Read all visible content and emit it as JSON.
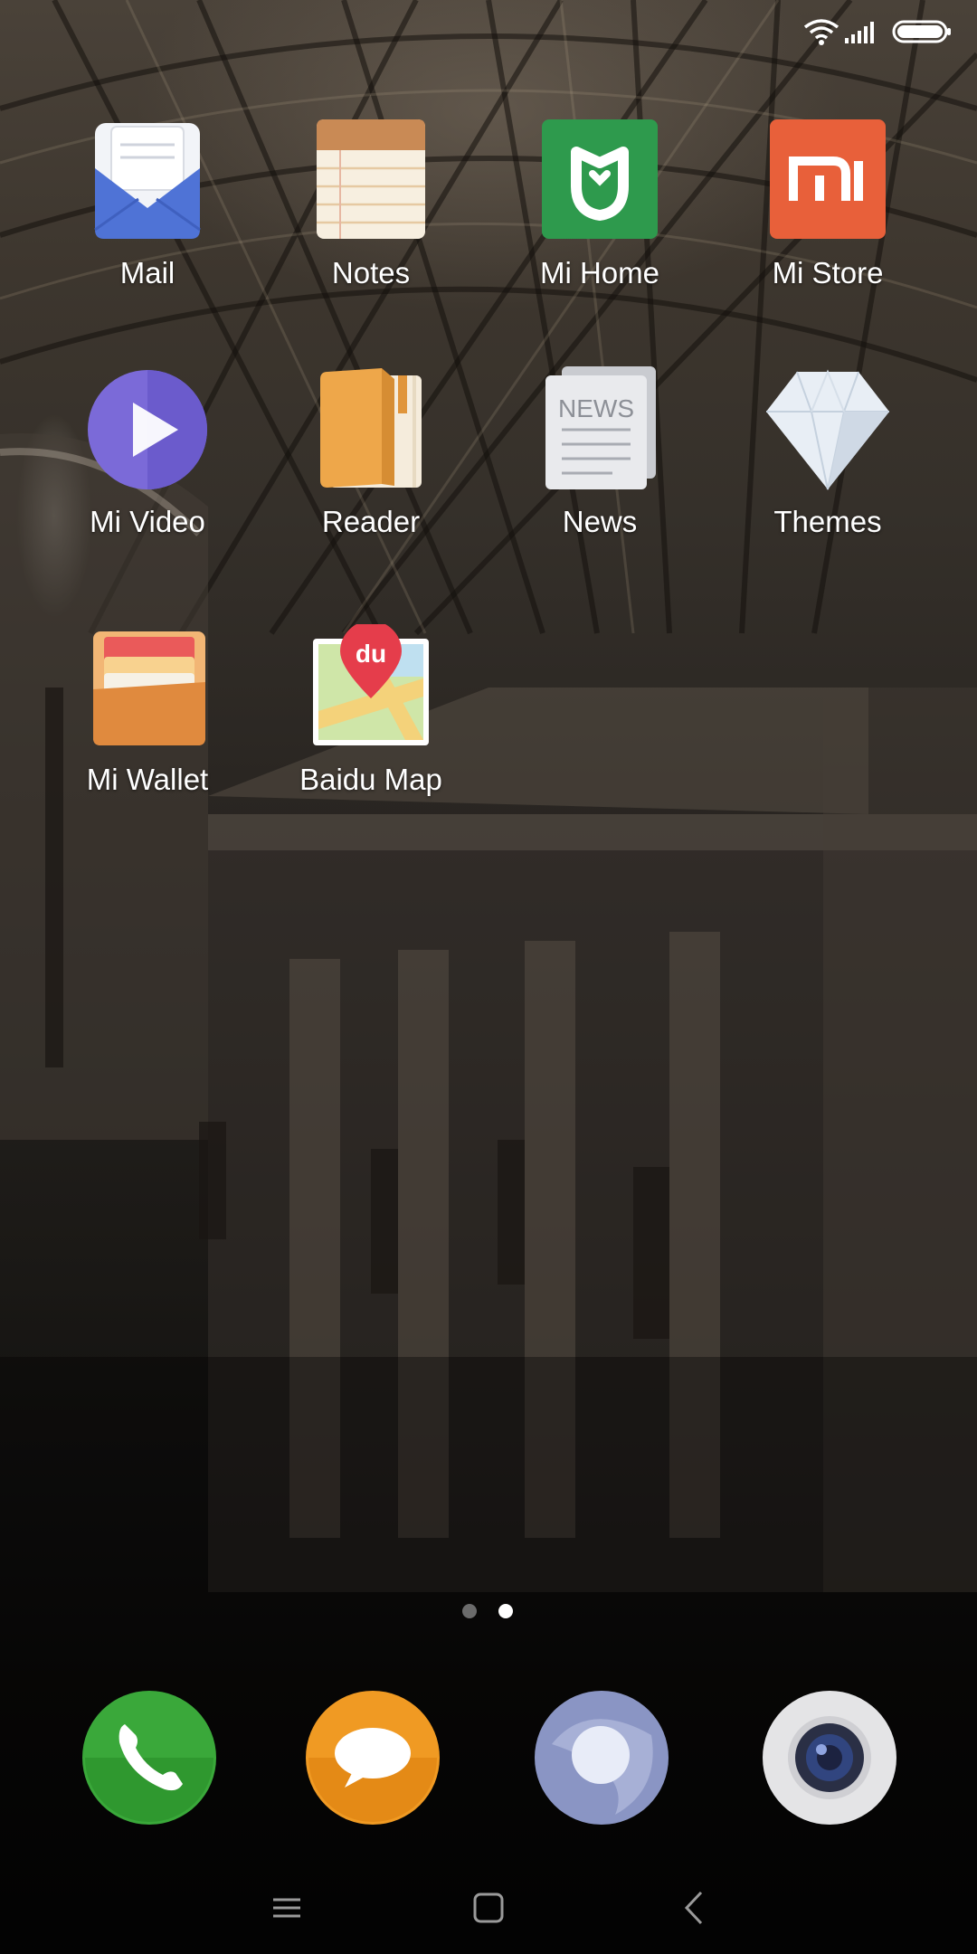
{
  "status_bar": {
    "wifi_icon": "wifi-icon",
    "signal_icon": "cell-signal-icon",
    "battery_icon": "battery-icon"
  },
  "apps": [
    {
      "label": "Mail",
      "icon": "mail-icon"
    },
    {
      "label": "Notes",
      "icon": "notes-icon"
    },
    {
      "label": "Mi Home",
      "icon": "mi-home-icon"
    },
    {
      "label": "Mi Store",
      "icon": "mi-store-icon"
    },
    {
      "label": "Mi Video",
      "icon": "mi-video-icon"
    },
    {
      "label": "Reader",
      "icon": "reader-icon"
    },
    {
      "label": "News",
      "icon": "news-icon"
    },
    {
      "label": "Themes",
      "icon": "themes-icon"
    },
    {
      "label": "Mi Wallet",
      "icon": "mi-wallet-icon"
    },
    {
      "label": "Baidu Map",
      "icon": "baidu-map-icon"
    }
  ],
  "icon_text": {
    "news_badge": "NEWS",
    "baidu_badge": "du"
  },
  "page_indicator": {
    "total_pages": 2,
    "current_page": 2
  },
  "dock": [
    {
      "icon": "phone-icon"
    },
    {
      "icon": "messaging-icon"
    },
    {
      "icon": "browser-icon"
    },
    {
      "icon": "camera-icon"
    }
  ],
  "nav_bar": {
    "menu_icon": "menu-icon",
    "home_icon": "home-icon",
    "back_icon": "back-icon"
  },
  "colors": {
    "mail_blue": "#4f73d6",
    "mi_home_green": "#2e9a4d",
    "mi_store_orange": "#e8603a",
    "mi_video_purple": "#7b6ad8",
    "reader_orange": "#eea74a",
    "phone_green": "#3aa83a",
    "messaging_orange": "#f09a23"
  }
}
